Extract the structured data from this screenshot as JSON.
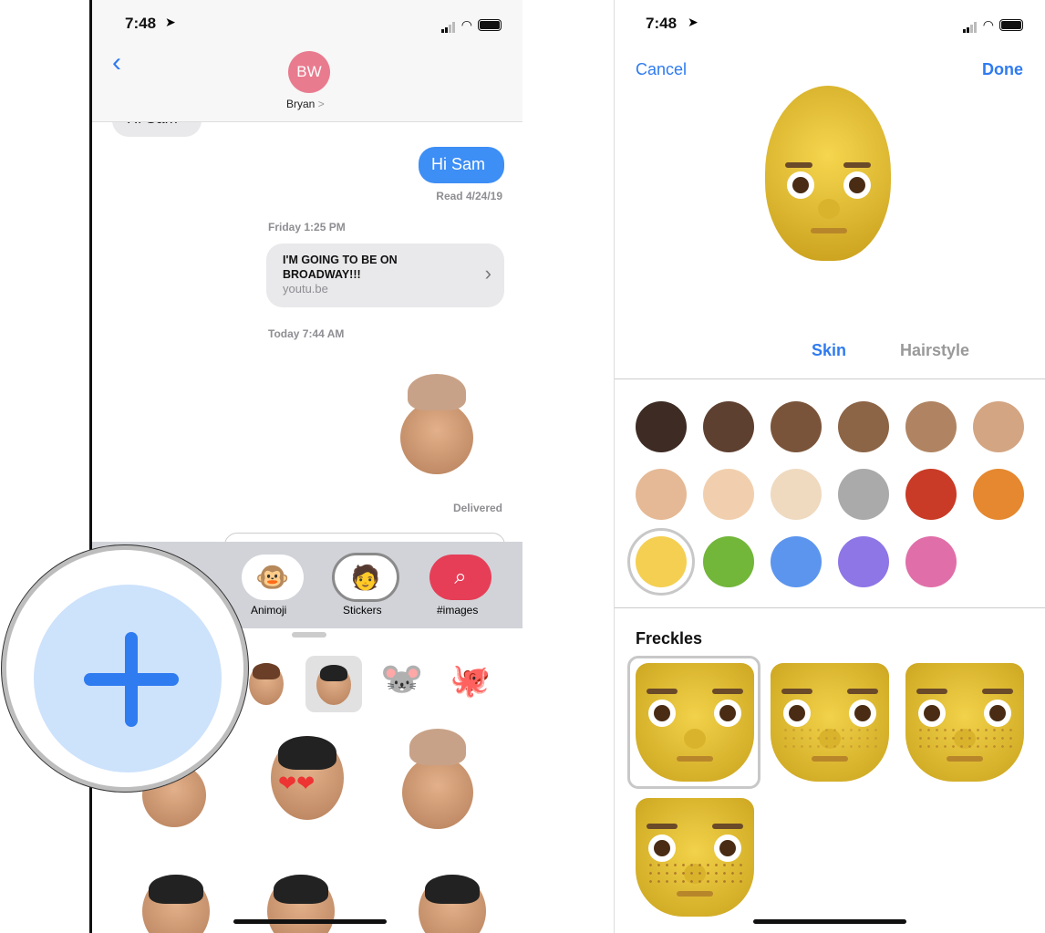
{
  "left": {
    "status": {
      "time": "7:48"
    },
    "header": {
      "avatar_initials": "BW",
      "contact_name": "Bryan",
      "chevron": ">",
      "avatar_color": "#e97b8f"
    },
    "messages": {
      "partial_received": "Hi Sam",
      "sent": "Hi Sam",
      "read_receipt": "Read 4/24/19",
      "timestamp1": "Friday 1:25 PM",
      "link_title": "I'M GOING TO BE ON BROADWAY!!!",
      "link_domain": "youtu.be",
      "timestamp2": "Today 7:44 AM",
      "delivered": "Delivered"
    },
    "app_drawer": {
      "apps": [
        {
          "label": "Animoji",
          "icon": "monkey-animoji-icon"
        },
        {
          "label": "Stickers",
          "icon": "memoji-stickers-icon"
        },
        {
          "label": "#images",
          "icon": "globe-search-icon"
        }
      ]
    },
    "magnifier": {
      "icon": "plus-icon",
      "accent": "#2f7bf0"
    }
  },
  "right": {
    "status": {
      "time": "7:48"
    },
    "nav": {
      "cancel": "Cancel",
      "done": "Done",
      "accent": "#2f7bf0"
    },
    "tabs": [
      {
        "label": "Skin",
        "active": true
      },
      {
        "label": "Hairstyle",
        "active": false
      }
    ],
    "skin_colors": [
      "#3d2b24",
      "#5e4030",
      "#7a543a",
      "#8c6446",
      "#b08462",
      "#d3a583",
      "#e5b995",
      "#f1cfae",
      "#efdac0",
      "#aaaaaa",
      "#c93b26",
      "#e5882f",
      "#f5cf52",
      "#72b63a",
      "#5b95ee",
      "#8e76e6",
      "#e06fa9"
    ],
    "selected_skin": "#f5cf52",
    "freckles": {
      "title": "Freckles",
      "options": [
        "none",
        "light",
        "medium",
        "heavy"
      ],
      "selected": "none"
    }
  }
}
